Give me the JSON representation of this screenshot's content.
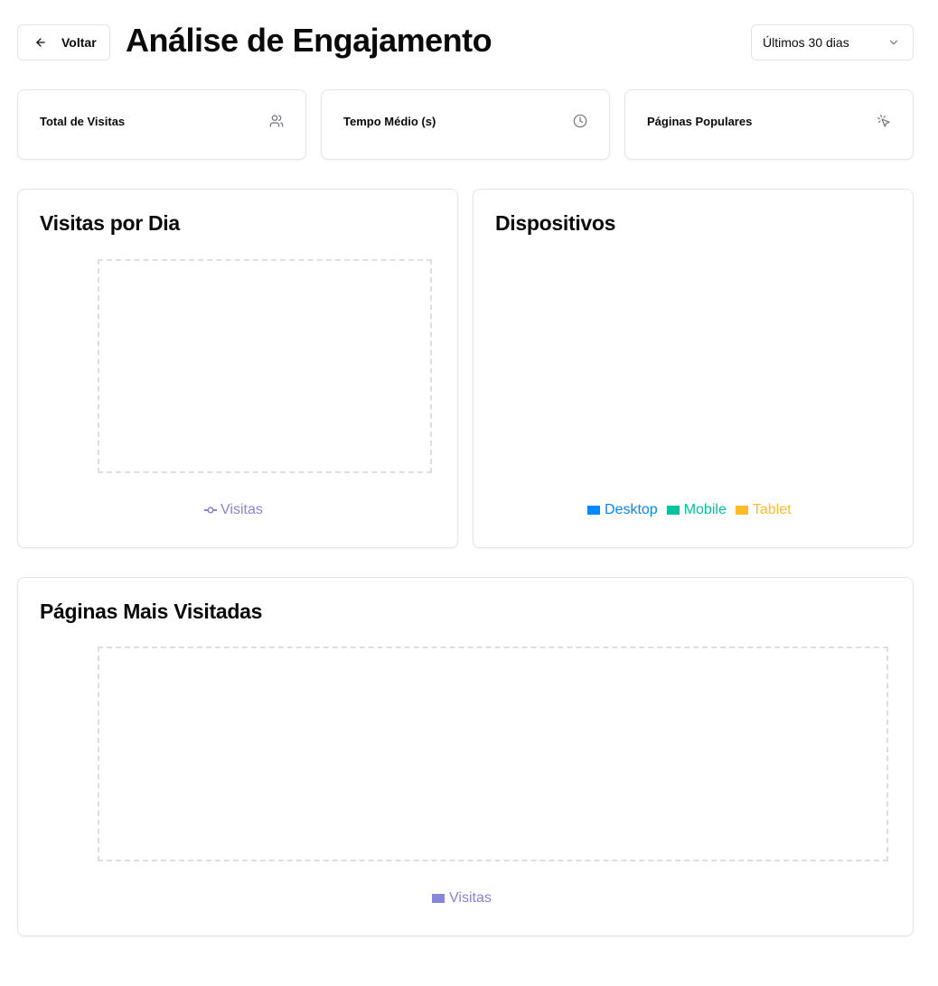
{
  "header": {
    "back_label": "Voltar",
    "title": "Análise de Engajamento",
    "period_select": {
      "selected": "Últimos 30 dias"
    }
  },
  "stats": [
    {
      "label": "Total de Visitas",
      "icon": "users-icon"
    },
    {
      "label": "Tempo Médio (s)",
      "icon": "clock-icon"
    },
    {
      "label": "Páginas Populares",
      "icon": "mouse-pointer-click-icon"
    }
  ],
  "charts": {
    "visits_per_day": {
      "title": "Visitas por Dia",
      "legend": [
        {
          "name": "Visitas",
          "color": "#8884d8"
        }
      ]
    },
    "devices": {
      "title": "Dispositivos",
      "legend": [
        {
          "name": "Desktop",
          "color": "#0088fe"
        },
        {
          "name": "Mobile",
          "color": "#00c49f"
        },
        {
          "name": "Tablet",
          "color": "#ffbb28"
        }
      ]
    },
    "top_pages": {
      "title": "Páginas Mais Visitadas",
      "legend": [
        {
          "name": "Visitas",
          "color": "#8884d8"
        }
      ]
    }
  }
}
